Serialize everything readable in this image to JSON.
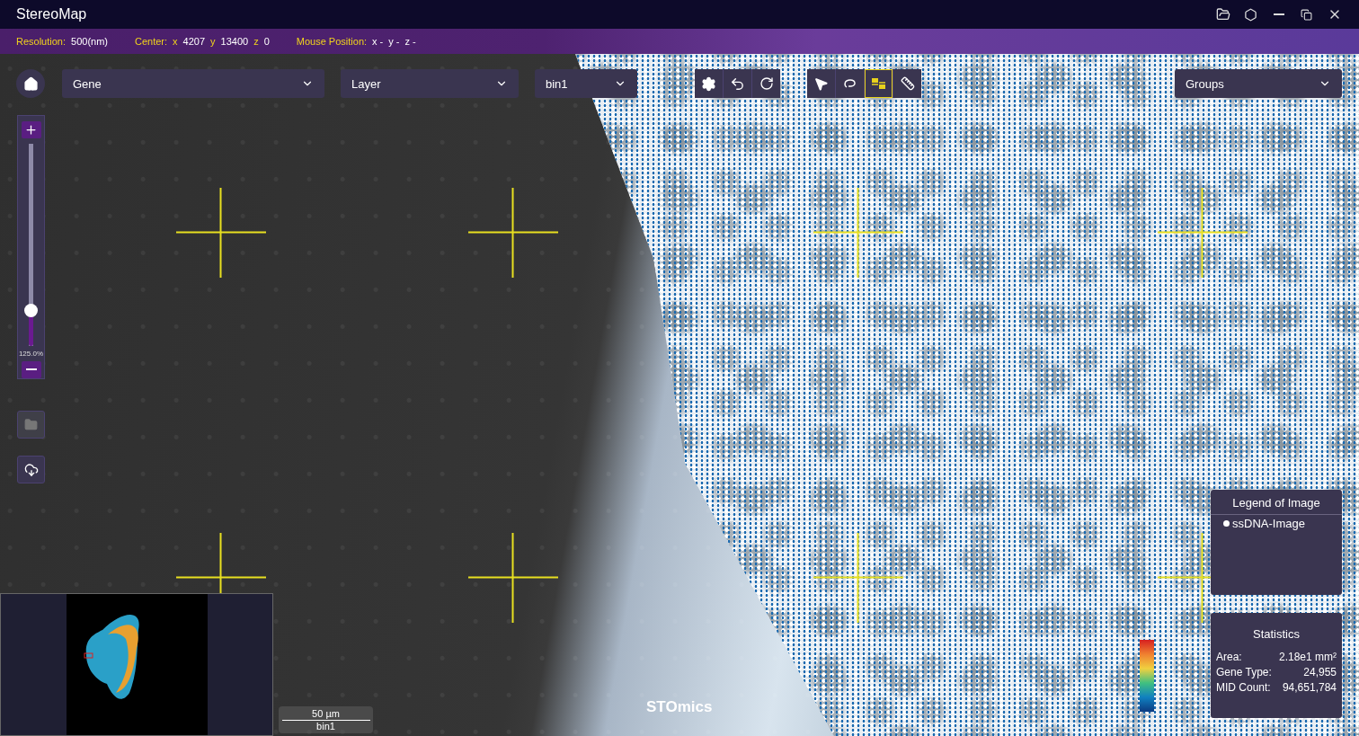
{
  "window": {
    "title": "StereoMap"
  },
  "info_bar": [
    {
      "label": "Resolution:",
      "values": [
        {
          "text": "500(nm)"
        }
      ]
    },
    {
      "label": "Center:",
      "values": [
        {
          "axis": "x",
          "text": "4207"
        },
        {
          "axis": "y",
          "text": "13400"
        },
        {
          "axis": "z",
          "text": "0"
        }
      ]
    },
    {
      "label": "Mouse Position:",
      "values": [
        {
          "text": "x -"
        },
        {
          "text": "y -"
        },
        {
          "text": "z -"
        }
      ]
    }
  ],
  "dropdowns": [
    {
      "label": "Gene"
    },
    {
      "label": "Layer"
    },
    {
      "label": "bin1"
    }
  ],
  "groups_dropdown": {
    "label": "Groups"
  },
  "toolbars": [
    [
      {
        "kind": "settings",
        "selected": false
      },
      {
        "kind": "undo",
        "selected": false
      },
      {
        "kind": "redo",
        "selected": false
      }
    ],
    [
      {
        "kind": "pointer",
        "selected": false
      },
      {
        "kind": "lasso",
        "selected": false
      },
      {
        "kind": "squares",
        "selected": true
      },
      {
        "kind": "ruler",
        "selected": false
      }
    ]
  ],
  "zoom": {
    "level": 0.15,
    "reading": "125.0%"
  },
  "side_buttons": [
    {
      "kind": "folder",
      "disabled": true
    },
    {
      "kind": "cloud",
      "disabled": false
    }
  ],
  "legend": {
    "title": "Legend of Image",
    "items": [
      {
        "label": "ssDNA-Image"
      }
    ]
  },
  "statistics": {
    "title": "Statistics",
    "rows": [
      {
        "label": "Area:",
        "value": "2.18e1 mm²"
      },
      {
        "label": "Gene Type:",
        "value": "24,955"
      },
      {
        "label": "MID Count:",
        "value": "94,651,784"
      }
    ]
  },
  "scale_bar": {
    "length": "50 µm",
    "bin": "bin1"
  },
  "logo": "STOmics"
}
